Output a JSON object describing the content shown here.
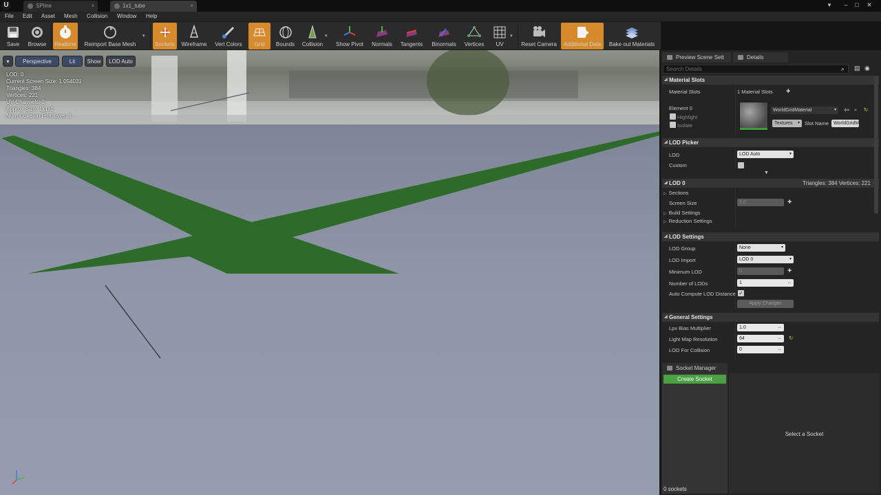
{
  "tabs": [
    {
      "label": "SPline",
      "icon": "static-mesh-icon"
    },
    {
      "label": "1x1_tube",
      "icon": "static-mesh-icon"
    }
  ],
  "menu": [
    "File",
    "Edit",
    "Asset",
    "Mesh",
    "Collision",
    "Window",
    "Help"
  ],
  "toolbar": {
    "save": "Save",
    "browse": "Browse",
    "realtime": "Realtime",
    "reimport": "Reimport Base Mesh",
    "sockets": "Sockets",
    "wireframe": "Wireframe",
    "vert_colors": "Vert Colors",
    "grid": "Grid",
    "bounds": "Bounds",
    "collision": "Collision",
    "show_pivot": "Show Pivot",
    "normals": "Normals",
    "tangents": "Tangents",
    "binormals": "Binormals",
    "vertices": "Vertices",
    "uv": "UV",
    "reset_camera": "Reset Camera",
    "additional_data": "Additional Data",
    "bake_out": "Bake out Materials",
    "accent_color": "#d78a2b"
  },
  "viewport": {
    "perspective": "Perspective",
    "lit": "Lit",
    "show": "Show",
    "lod": "LOD Auto",
    "stats": [
      "LOD:  0",
      "Current Screen Size:  1.054031",
      "Triangles:  384",
      "Vertices:  221",
      "UV Channels:  2",
      "Approx Size: 1x1x1",
      "Num Collision Primitives:  1"
    ],
    "mesh_color": "#2e6a2a"
  },
  "panel": {
    "tab_preview": "Preview Scene Sett",
    "tab_details": "Details",
    "search_placeholder": "Search Details",
    "material_slots": {
      "header": "Material Slots",
      "label": "Material Slots",
      "count": "1 Material Slots",
      "element": "Element 0",
      "highlight": "Highlight",
      "isolate": "Isolate",
      "material": "WorldGridMaterial",
      "textures": "Textures",
      "slot_name_label": "Slot Name",
      "slot_name": "WorldGridM"
    },
    "lod_picker": {
      "header": "LOD Picker",
      "lod_label": "LOD",
      "lod_value": "LOD Auto",
      "custom_label": "Custom"
    },
    "lod0": {
      "header": "LOD 0",
      "summary": "Triangles: 384   Vertices: 221",
      "sections": "Sections",
      "screen_size_label": "Screen Size",
      "screen_size": "1.0",
      "build_settings": "Build Settings",
      "reduction_settings": "Reduction Settings"
    },
    "lod_settings": {
      "header": "LOD Settings",
      "lod_group_label": "LOD Group",
      "lod_group": "None",
      "lod_import_label": "LOD Import",
      "lod_import": "LOD 0",
      "min_lod_label": "Minimum LOD",
      "min_lod": "0",
      "num_lods_label": "Number of LODs",
      "num_lods": "1",
      "auto_compute_label": "Auto Compute LOD Distance",
      "apply_changes": "Apply Changes"
    },
    "general": {
      "header": "General Settings",
      "lpv_label": "Lpv Bias Multiplier",
      "lpv": "1.0",
      "lightmap_label": "Light Map Resolution",
      "lightmap": "64",
      "lod_collision_label": "LOD For Collision",
      "lod_collision": "0"
    }
  },
  "socket_manager": {
    "title": "Socket Manager",
    "create": "Create Socket",
    "count": "0 sockets",
    "empty": "Select a Socket"
  }
}
